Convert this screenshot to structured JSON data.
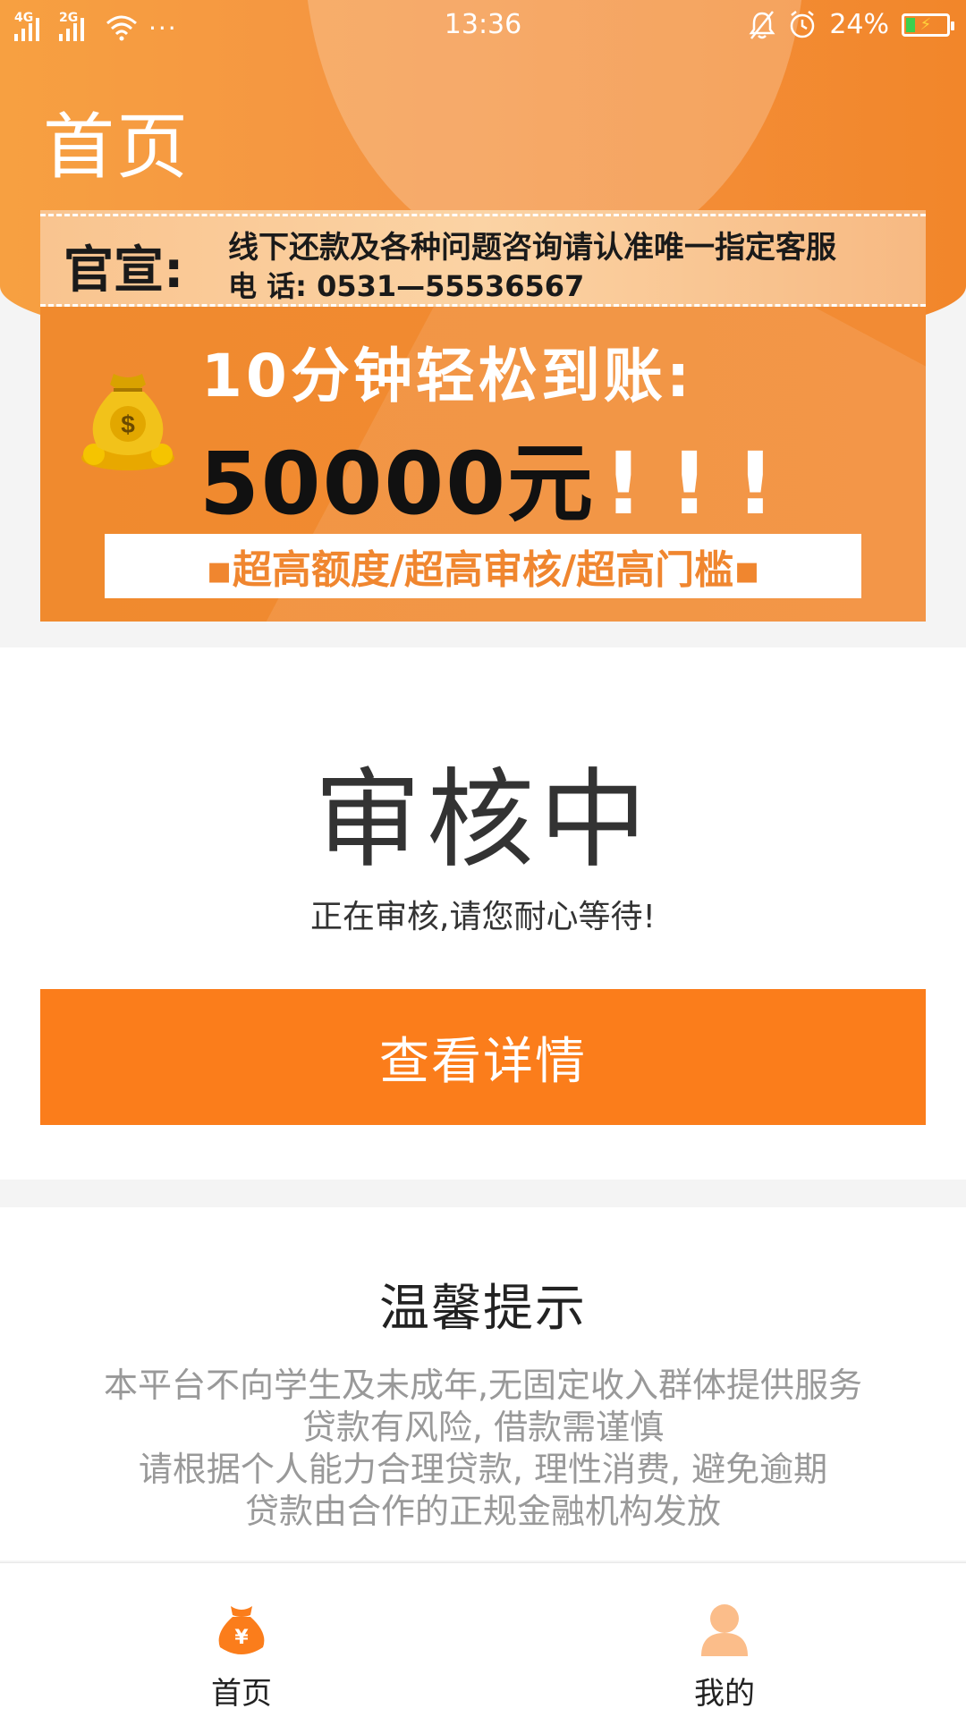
{
  "status_bar": {
    "network_1": "4G",
    "network_2": "2G",
    "more": "···",
    "time": "13:36",
    "battery": "24%"
  },
  "header": {
    "title": "首页"
  },
  "banner": {
    "official_label": "官宣:",
    "notice_line1": "线下还款及各种问题咨询请认准唯一指定客服",
    "notice_line2": "电 话: 0531—55536567",
    "promo_line": "10分钟轻松到账:",
    "amount": "50000元",
    "exclaim": "!!!",
    "features": "▪超高额度/超高审核/超高门槛▪"
  },
  "status_card": {
    "title": "审核中",
    "description": "正在审核,请您耐心等待!",
    "button_label": "查看详情"
  },
  "tips": {
    "title": "温馨提示",
    "lines": [
      "本平台不向学生及未成年,无固定收入群体提供服务",
      "贷款有风险, 借款需谨慎",
      "请根据个人能力合理贷款, 理性消费, 避免逾期",
      "贷款由合作的正规金融机构发放"
    ]
  },
  "bottom_nav": {
    "items": [
      {
        "label": "首页",
        "icon": "money-bag-icon"
      },
      {
        "label": "我的",
        "icon": "user-icon"
      }
    ]
  },
  "colors": {
    "accent": "#fb7d1b",
    "header_gradient_start": "#f7a041",
    "header_gradient_end": "#f2862a",
    "tips_text": "#999999",
    "inactive_icon": "#fbbd8a"
  }
}
